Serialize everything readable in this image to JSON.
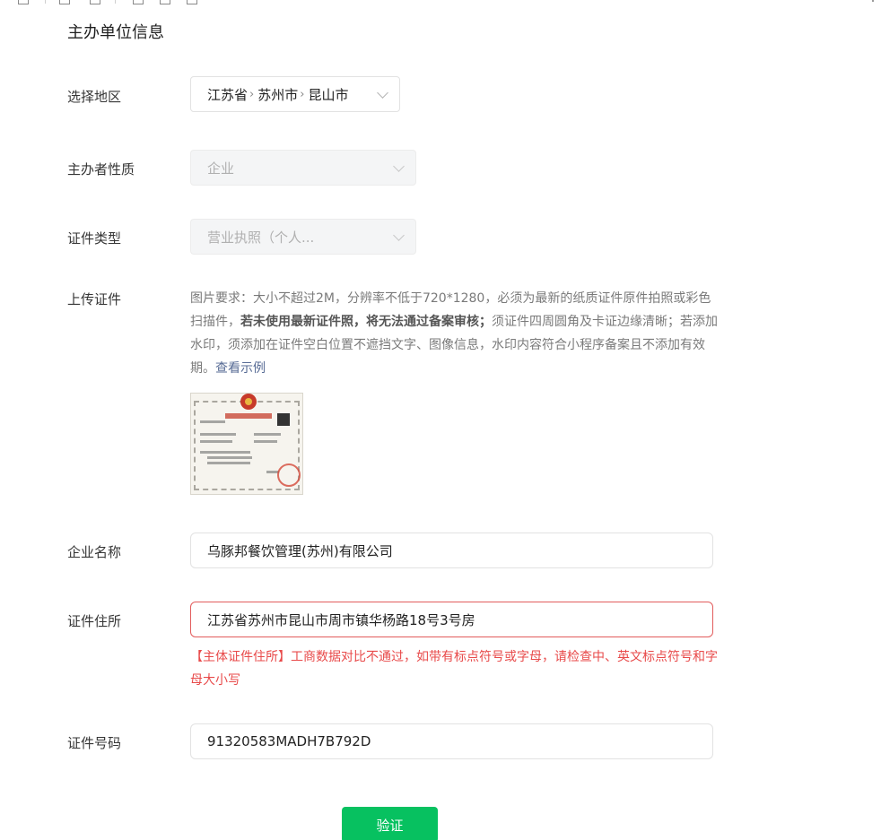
{
  "section": {
    "title": "主办单位信息"
  },
  "labels": {
    "region": "选择地区",
    "sponsor_type": "主办者性质",
    "cert_type": "证件类型",
    "upload": "上传证件",
    "company_name": "企业名称",
    "cert_address": "证件住所",
    "cert_number": "证件号码"
  },
  "region": {
    "province": "江苏省",
    "city": "苏州市",
    "district": "昆山市",
    "separator": "›"
  },
  "sponsor_type": {
    "value": "企业"
  },
  "cert_type": {
    "value": "营业执照（个人..."
  },
  "upload": {
    "req_part1": "图片要求：大小不超过2M，分辨率不低于720*1280，必须为最新的纸质证件原件拍照或彩色扫描件，",
    "req_bold": "若未使用最新证件照，将无法通过备案审核；",
    "req_part2": "须证件四周圆角及卡证边缘清晰；若添加水印，须添加在证件空白位置不遮挡文字、图像信息，水印内容符合小程序备案且不添加有效期。",
    "example_link": "查看示例"
  },
  "company_name": {
    "value": "乌豚邦餐饮管理(苏州)有限公司"
  },
  "cert_address": {
    "value": "江苏省苏州市昆山市周市镇华杨路18号3号房",
    "error": "【主体证件住所】工商数据对比不通过，如带有标点符号或字母，请检查中、英文标点符号和字母大小写"
  },
  "cert_number": {
    "value": "91320583MADH7B792D"
  },
  "verify_button": {
    "label": "验证"
  },
  "colors": {
    "primary": "#07c160",
    "error": "#e84a4a",
    "link": "#576b95"
  }
}
